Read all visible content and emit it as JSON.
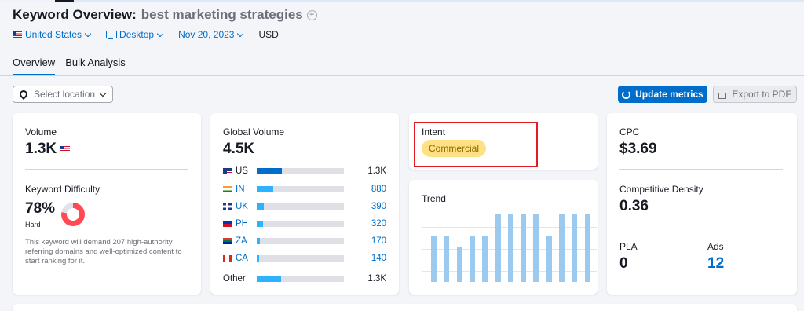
{
  "header": {
    "title_prefix": "Keyword Overview:",
    "keyword": "best marketing strategies",
    "add_icon": "plus-circle-icon"
  },
  "filters": {
    "country": "United States",
    "device": "Desktop",
    "date": "Nov 20, 2023",
    "currency": "USD"
  },
  "tabs": [
    {
      "label": "Overview",
      "active": true
    },
    {
      "label": "Bulk Analysis",
      "active": false
    }
  ],
  "toolbar": {
    "location_placeholder": "Select location",
    "update_label": "Update metrics",
    "export_label": "Export to PDF"
  },
  "volume_card": {
    "volume_label": "Volume",
    "volume_value": "1.3K",
    "kd_label": "Keyword Difficulty",
    "kd_value": "78%",
    "kd_percent": 78,
    "kd_level": "Hard",
    "kd_description": "This keyword will demand 207 high-authority referring domains and well-optimized content to start ranking for it."
  },
  "global_card": {
    "label": "Global Volume",
    "value": "4.5K",
    "rows": [
      {
        "code": "US",
        "value": "1.3K",
        "share": 0.29,
        "fill": "#006dca",
        "code_color": "#171a22",
        "value_color": "#171a22"
      },
      {
        "code": "IN",
        "value": "880",
        "share": 0.19,
        "fill": "#2bb3ff",
        "code_color": "#006dca",
        "value_color": "#006dca"
      },
      {
        "code": "UK",
        "value": "390",
        "share": 0.08,
        "fill": "#2bb3ff",
        "code_color": "#006dca",
        "value_color": "#006dca"
      },
      {
        "code": "PH",
        "value": "320",
        "share": 0.07,
        "fill": "#2bb3ff",
        "code_color": "#006dca",
        "value_color": "#006dca"
      },
      {
        "code": "ZA",
        "value": "170",
        "share": 0.04,
        "fill": "#2bb3ff",
        "code_color": "#006dca",
        "value_color": "#006dca"
      },
      {
        "code": "CA",
        "value": "140",
        "share": 0.03,
        "fill": "#2bb3ff",
        "code_color": "#006dca",
        "value_color": "#006dca"
      }
    ],
    "other_label": "Other",
    "other_value": "1.3K",
    "other_share": 0.28
  },
  "intent_card": {
    "label": "Intent",
    "badge": "Commercial"
  },
  "trend_card": {
    "label": "Trend",
    "values": [
      0.67,
      0.67,
      0.51,
      0.67,
      0.67,
      1.0,
      1.0,
      1.0,
      1.0,
      0.67,
      1.0,
      1.0,
      1.0
    ]
  },
  "cpc_card": {
    "cpc_label": "CPC",
    "cpc_value": "$3.69",
    "density_label": "Competitive Density",
    "density_value": "0.36",
    "pla_label": "PLA",
    "pla_value": "0",
    "ads_label": "Ads",
    "ads_value": "12"
  }
}
